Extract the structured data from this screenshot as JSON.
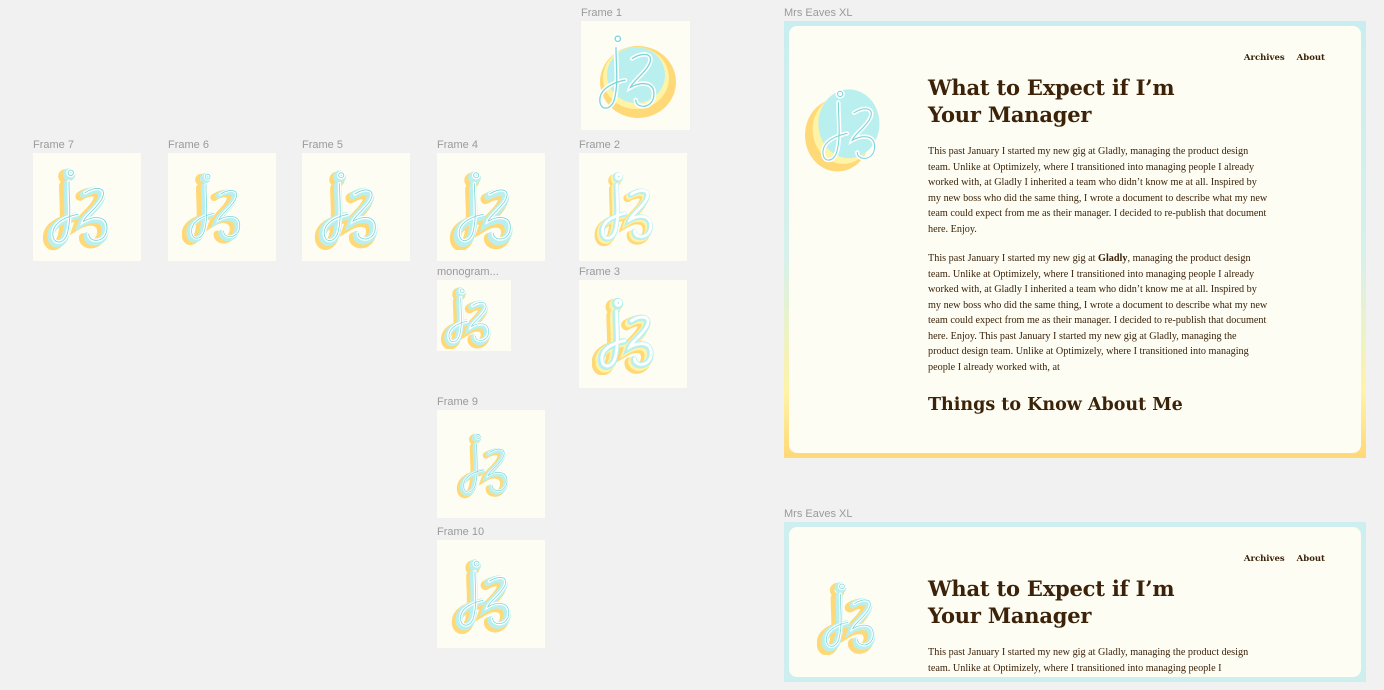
{
  "canvas": {
    "frames": [
      {
        "id": "frame7",
        "label": "Frame 7"
      },
      {
        "id": "frame6",
        "label": "Frame 6"
      },
      {
        "id": "frame5",
        "label": "Frame 5"
      },
      {
        "id": "frame4",
        "label": "Frame 4"
      },
      {
        "id": "monogram",
        "label": "monogram..."
      },
      {
        "id": "frame9",
        "label": "Frame 9"
      },
      {
        "id": "frame10",
        "label": "Frame 10"
      },
      {
        "id": "frame1",
        "label": "Frame 1"
      },
      {
        "id": "frame2",
        "label": "Frame 2"
      },
      {
        "id": "frame3",
        "label": "Frame 3"
      }
    ],
    "mockups": [
      {
        "label": "Mrs Eaves XL"
      },
      {
        "label": "Mrs Eaves XL"
      }
    ]
  },
  "page": {
    "nav": {
      "archives": "Archives",
      "about": "About"
    },
    "title_line1": "What to Expect if I’m",
    "title_line2": "Your Manager",
    "para1": "This past January I started my new gig at Gladly, managing the product design team. Unlike at Optimizely, where I transitioned into managing people I already worked with, at Gladly I inherited a team who didn’t know me at all. Inspired by my new boss who did the same thing, I wrote a document to describe what my new team could expect from me as their manager. I decided to re-publish that document here. Enjoy.",
    "para2_before": "This past January I started my new gig at ",
    "para2_bold": "Gladly",
    "para2_after": ", managing the product design team. Unlike at Optimizely, where I transitioned into managing people I already worked with, at Gladly I inherited a team who didn’t know me at all. Inspired by my new boss who did the same thing, I wrote a document to describe what my new team could expect from me as their manager. I decided to re-publish that document here. Enjoy. This past January I started my new gig at Gladly, managing the product design team. Unlike at Optimizely, where I transitioned into managing people I already worked with, at",
    "heading2": "Things to Know About Me",
    "para_short": "This past January I started my new gig at Gladly, managing the product design team. Unlike at Optimizely, where I transitioned into managing people I"
  },
  "colors": {
    "canvas_bg": "#f1f1f1",
    "frame_bg": "#fdfdf4",
    "text_brown": "#3b2208",
    "logo_yellow": "#ffd877",
    "logo_teal": "#b9f0ef",
    "logo_white": "#ffffff",
    "label_gray": "#9a9a9a"
  }
}
